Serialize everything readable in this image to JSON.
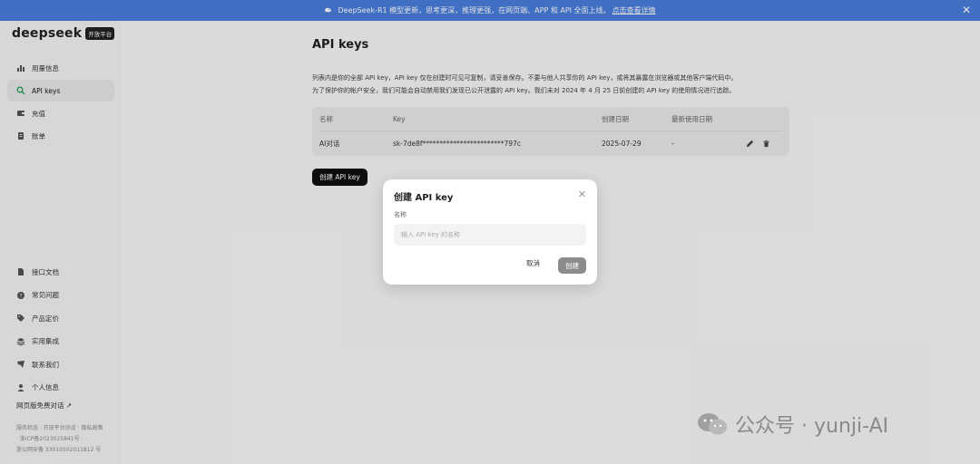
{
  "banner": {
    "icon": "whale-icon",
    "text": "DeepSeek-R1 模型更新，思考更深，推理更强，在网页端、APP 和 API 全面上线。",
    "link": "点击查看详情"
  },
  "sidebar": {
    "logo": "deepseek",
    "badge": "开放平台",
    "items": [
      {
        "label": "用量信息",
        "icon": "bar-chart-icon"
      },
      {
        "label": "API keys",
        "icon": "search-key-icon"
      },
      {
        "label": "充值",
        "icon": "wallet-icon"
      },
      {
        "label": "账单",
        "icon": "bill-icon"
      }
    ],
    "bottom_items": [
      {
        "label": "接口文档",
        "icon": "document-icon"
      },
      {
        "label": "常见问题",
        "icon": "help-icon"
      },
      {
        "label": "产品定价",
        "icon": "price-tag-icon"
      },
      {
        "label": "实用集成",
        "icon": "layers-icon"
      },
      {
        "label": "联系我们",
        "icon": "contact-icon"
      },
      {
        "label": "个人信息",
        "icon": "user-icon"
      }
    ],
    "free_chat": "网页版免费对话 ↗",
    "footer": {
      "line1": "服务状态 · 开放平台协议 · 隐私政策",
      "line2": "· 浙ICP备2023025841号 ·",
      "line3": "浙公网安备 33010502011812 号"
    }
  },
  "main": {
    "title": "API keys",
    "desc_line1": "列表内是你的全部 API key，API key 仅在创建时可见可复制，请妥善保存。不要与他人共享你的 API key，或将其暴露在浏览器或其他客户端代码中。",
    "desc_line2": "为了保护你的帐户安全，我们可能会自动禁用我们发现已公开泄露的 API key。我们未对 2024 年 4 月 25 日前创建的 API key 的使用情况进行追踪。",
    "table": {
      "headers": [
        "名称",
        "Key",
        "创建日期",
        "最新使用日期"
      ],
      "rows": [
        {
          "name": "AI对话",
          "key": "sk-7de8f************************797c",
          "created": "2025-07-29",
          "last_used": "-"
        }
      ]
    },
    "create_button": "创建 API key"
  },
  "modal": {
    "title": "创建 API key",
    "field_label": "名称",
    "input_placeholder": "输入 API key 的名称",
    "input_value": "",
    "cancel": "取消",
    "confirm": "创建"
  },
  "watermark": "公众号 · yunji-AI",
  "colors": {
    "banner": "#4b7fe0",
    "active_icon": "#26a35a",
    "primary_button": "#111111",
    "disabled_button": "#8c8c8c"
  }
}
